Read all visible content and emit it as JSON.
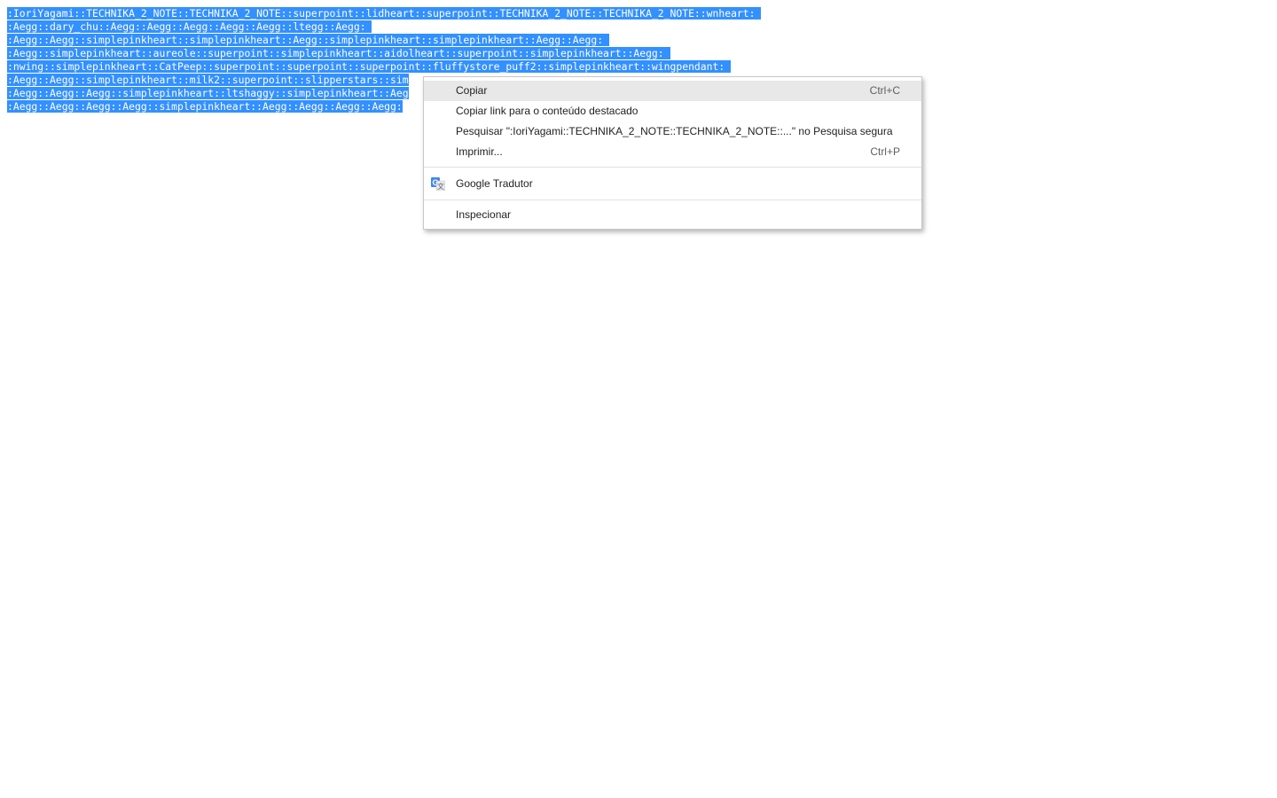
{
  "document": {
    "lines": [
      ":IoriYagami::TECHNIKA_2_NOTE::TECHNIKA_2_NOTE::superpoint::lidheart::superpoint::TECHNIKA_2_NOTE::TECHNIKA_2_NOTE::wnheart: ",
      ":Aegg::dary_chu::Aegg::Aegg::Aegg::Aegg::Aegg::ltegg::Aegg: ",
      ":Aegg::Aegg::simplepinkheart::simplepinkheart::Aegg::simplepinkheart::simplepinkheart::Aegg::Aegg: ",
      ":Aegg::simplepinkheart::aureole::superpoint::simplepinkheart::aidolheart::superpoint::simplepinkheart::Aegg: ",
      ":nwing::simplepinkheart::CatPeep::superpoint::superpoint::superpoint::fluffystore_puff2::simplepinkheart::wingpendant: ",
      ":Aegg::Aegg::simplepinkheart::milk2::superpoint::slipperstars::sim",
      ":Aegg::Aegg::Aegg::simplepinkheart::ltshaggy::simplepinkheart::Aeg",
      ":Aegg::Aegg::Aegg::Aegg::simplepinkheart::Aegg::Aegg::Aegg::Aegg:"
    ],
    "selection_color": "#3390ff"
  },
  "context_menu": {
    "items": [
      {
        "label": "Copiar",
        "shortcut": "Ctrl+C"
      },
      {
        "label": "Copiar link para o conteúdo destacado",
        "shortcut": ""
      },
      {
        "label": "Pesquisar \":IoriYagami::TECHNIKA_2_NOTE::TECHNIKA_2_NOTE::...\" no Pesquisa segura",
        "shortcut": ""
      },
      {
        "label": "Imprimir...",
        "shortcut": "Ctrl+P"
      },
      {
        "label": "Google Tradutor",
        "icon": "google-translate-icon"
      },
      {
        "label": "Inspecionar"
      }
    ]
  }
}
